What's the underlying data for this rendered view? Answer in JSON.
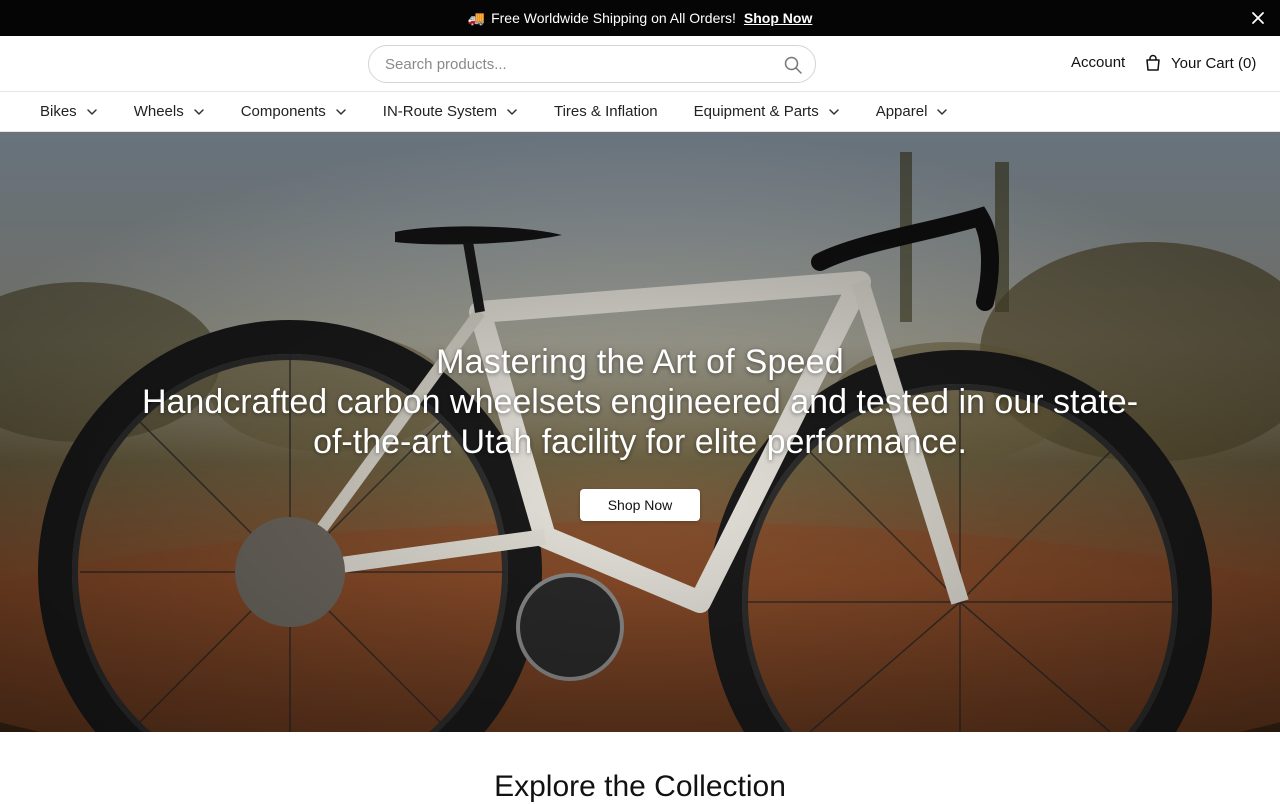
{
  "announcement": {
    "text": "Free Worldwide Shipping on All Orders!",
    "link_label": "Shop Now",
    "icon": "truck-icon"
  },
  "header": {
    "search_placeholder": "Search products...",
    "account_label": "Account",
    "cart_label": "Your Cart (0)"
  },
  "nav": {
    "items": [
      {
        "label": "Bikes",
        "has_dropdown": true
      },
      {
        "label": "Wheels",
        "has_dropdown": true
      },
      {
        "label": "Components",
        "has_dropdown": true
      },
      {
        "label": "IN-Route System",
        "has_dropdown": true
      },
      {
        "label": "Tires & Inflation",
        "has_dropdown": false
      },
      {
        "label": "Equipment & Parts",
        "has_dropdown": true
      },
      {
        "label": "Apparel",
        "has_dropdown": true
      }
    ]
  },
  "hero": {
    "title": "Mastering the Art of Speed",
    "subtitle": "Handcrafted carbon wheelsets engineered and tested in our state-of-the-art Utah facility for elite performance.",
    "button_label": "Shop Now",
    "image_description_icon": "gravel-bike-photo"
  },
  "section": {
    "heading": "Explore the Collection"
  },
  "colors": {
    "announcement_bg": "#050505",
    "text": "#111111",
    "border": "#e6e6e6"
  }
}
